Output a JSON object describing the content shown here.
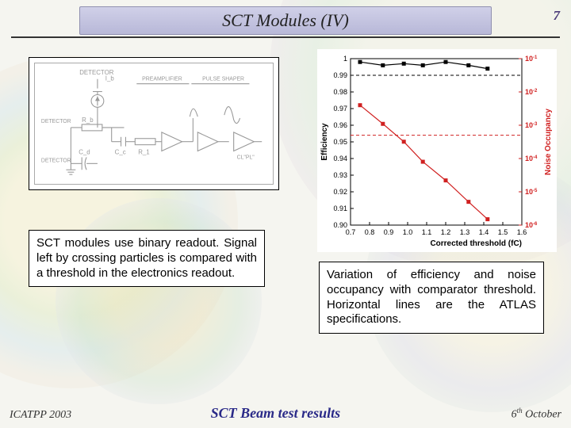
{
  "header": {
    "title": "SCT Modules (IV)",
    "page_number": "7"
  },
  "circuit": {
    "labels": [
      "DETECTOR",
      "DETECTOR",
      "PREAMPLIFIER",
      "PULSE SHAPER",
      "I_b",
      "R_b",
      "C_c",
      "R_1",
      "C_d",
      "CL",
      "PL"
    ]
  },
  "text_left": "SCT modules use binary readout. Signal left by crossing particles is compared with a threshold in the electronics readout.",
  "text_right": "Variation of efficiency and noise occupancy with comparator threshold. Horizontal lines are the ATLAS specifications.",
  "footer": {
    "left": "ICATPP 2003",
    "center": "SCT Beam test results",
    "right_pre": "6",
    "right_sup": "th",
    "right_post": " October"
  },
  "chart_data": {
    "type": "scatter",
    "title": "",
    "xlabel": "Corrected threshold (fC)",
    "ylabel_left": "Efficiency",
    "ylabel_right": "Noise Occupancy",
    "x_ticks": [
      0.7,
      0.8,
      0.9,
      1.0,
      1.1,
      1.2,
      1.3,
      1.4,
      1.5,
      1.6
    ],
    "y_left_ticks": [
      0.9,
      0.91,
      0.92,
      0.93,
      0.94,
      0.95,
      0.96,
      0.97,
      0.98,
      0.99,
      1.0
    ],
    "y_left_range": [
      0.9,
      1.0
    ],
    "y_right_ticks_log_exp": [
      -6,
      -5,
      -4,
      -3,
      -2,
      -1
    ],
    "y_right_type": "log",
    "series": [
      {
        "name": "Efficiency",
        "axis": "left",
        "color": "#000000",
        "marker": "square",
        "x": [
          0.75,
          0.87,
          0.98,
          1.08,
          1.2,
          1.32,
          1.42
        ],
        "values": [
          0.998,
          0.996,
          0.997,
          0.996,
          0.998,
          0.996,
          0.994
        ]
      },
      {
        "name": "Noise Occupancy",
        "axis": "right",
        "color": "#d02020",
        "marker": "square",
        "x": [
          0.75,
          0.87,
          0.98,
          1.08,
          1.2,
          1.32,
          1.42
        ],
        "values": [
          0.004,
          0.0011,
          0.00032,
          8e-05,
          2.2e-05,
          5e-06,
          1.5e-06
        ]
      }
    ],
    "spec_lines": [
      {
        "axis": "left",
        "value": 0.99,
        "style": "dashed",
        "color": "#000000"
      },
      {
        "axis": "right",
        "value": 0.0005,
        "style": "dashed",
        "color": "#d02020"
      }
    ]
  }
}
